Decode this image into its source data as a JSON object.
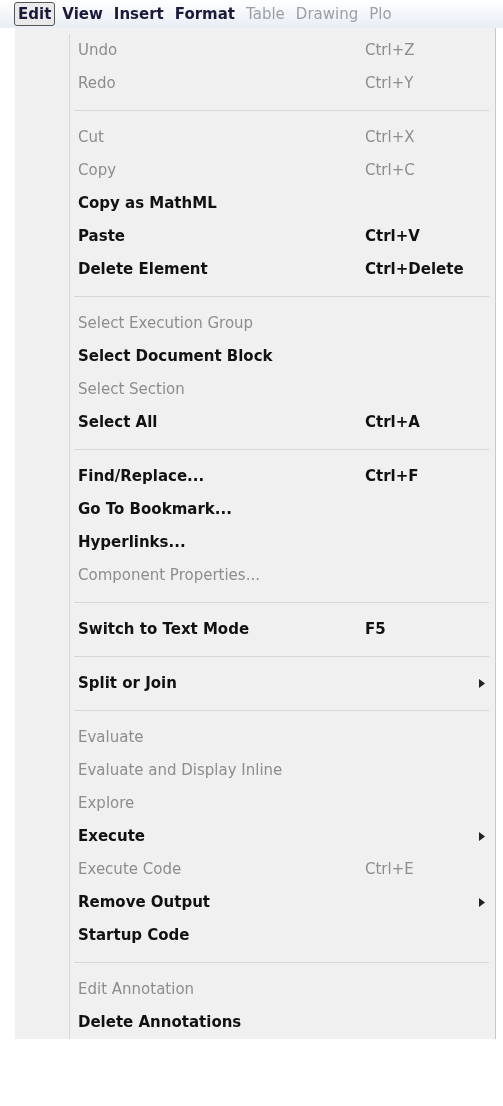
{
  "menu_bar": [
    {
      "label": "Edit",
      "selected": true,
      "disabled": false
    },
    {
      "label": "View",
      "selected": false,
      "disabled": false
    },
    {
      "label": "Insert",
      "selected": false,
      "disabled": false
    },
    {
      "label": "Format",
      "selected": false,
      "disabled": false
    },
    {
      "label": "Table",
      "selected": false,
      "disabled": true
    },
    {
      "label": "Drawing",
      "selected": false,
      "disabled": true
    },
    {
      "label": "Plo",
      "selected": false,
      "disabled": true
    }
  ],
  "menu": [
    {
      "kind": "item",
      "label": "Undo",
      "shortcut": "Ctrl+Z",
      "disabled": true,
      "submenu": false
    },
    {
      "kind": "item",
      "label": "Redo",
      "shortcut": "Ctrl+Y",
      "disabled": true,
      "submenu": false
    },
    {
      "kind": "separator"
    },
    {
      "kind": "item",
      "label": "Cut",
      "shortcut": "Ctrl+X",
      "disabled": true,
      "submenu": false
    },
    {
      "kind": "item",
      "label": "Copy",
      "shortcut": "Ctrl+C",
      "disabled": true,
      "submenu": false
    },
    {
      "kind": "item",
      "label": "Copy as MathML",
      "disabled": false,
      "submenu": false
    },
    {
      "kind": "item",
      "label": "Paste",
      "shortcut": "Ctrl+V",
      "disabled": false,
      "submenu": false
    },
    {
      "kind": "item",
      "label": "Delete Element",
      "shortcut": "Ctrl+Delete",
      "disabled": false,
      "submenu": false
    },
    {
      "kind": "separator"
    },
    {
      "kind": "item",
      "label": "Select Execution Group",
      "disabled": true,
      "submenu": false
    },
    {
      "kind": "item",
      "label": "Select Document Block",
      "disabled": false,
      "submenu": false
    },
    {
      "kind": "item",
      "label": "Select Section",
      "disabled": true,
      "submenu": false
    },
    {
      "kind": "item",
      "label": "Select All",
      "shortcut": "Ctrl+A",
      "disabled": false,
      "submenu": false
    },
    {
      "kind": "separator"
    },
    {
      "kind": "item",
      "label": "Find/Replace...",
      "shortcut": "Ctrl+F",
      "disabled": false,
      "submenu": false
    },
    {
      "kind": "item",
      "label": "Go To Bookmark...",
      "disabled": false,
      "submenu": false
    },
    {
      "kind": "item",
      "label": "Hyperlinks...",
      "disabled": false,
      "submenu": false
    },
    {
      "kind": "item",
      "label": "Component Properties...",
      "disabled": true,
      "submenu": false
    },
    {
      "kind": "separator"
    },
    {
      "kind": "item",
      "label": "Switch to Text Mode",
      "shortcut": "F5",
      "disabled": false,
      "submenu": false
    },
    {
      "kind": "separator"
    },
    {
      "kind": "item",
      "label": "Split or Join",
      "disabled": false,
      "submenu": true
    },
    {
      "kind": "separator"
    },
    {
      "kind": "item",
      "label": "Evaluate",
      "disabled": true,
      "submenu": false
    },
    {
      "kind": "item",
      "label": "Evaluate and Display Inline",
      "disabled": true,
      "submenu": false
    },
    {
      "kind": "item",
      "label": "Explore",
      "disabled": true,
      "submenu": false
    },
    {
      "kind": "item",
      "label": "Execute",
      "disabled": false,
      "submenu": true
    },
    {
      "kind": "item",
      "label": "Execute Code",
      "shortcut": "Ctrl+E",
      "disabled": true,
      "submenu": false
    },
    {
      "kind": "item",
      "label": "Remove Output",
      "disabled": false,
      "submenu": true
    },
    {
      "kind": "item",
      "label": "Startup Code",
      "disabled": false,
      "submenu": false
    },
    {
      "kind": "separator"
    },
    {
      "kind": "item",
      "label": "Edit Annotation",
      "disabled": true,
      "submenu": false
    },
    {
      "kind": "item",
      "label": "Delete Annotations",
      "disabled": false,
      "submenu": false
    }
  ]
}
